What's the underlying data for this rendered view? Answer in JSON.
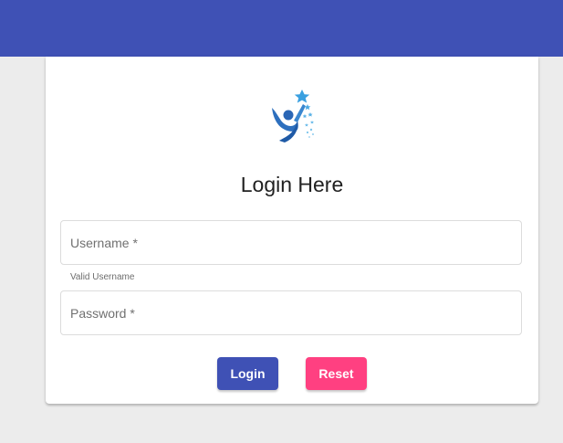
{
  "colors": {
    "topbar": "#3f51b5",
    "primary": "#3f51b5",
    "accent": "#ff4081",
    "background": "#ececec",
    "card": "#ffffff"
  },
  "logo": {
    "icon": "person-stars-logo"
  },
  "form": {
    "title": "Login Here",
    "username_placeholder": "Username *",
    "username_value": "",
    "username_hint": "Valid Username",
    "password_placeholder": "Password *",
    "password_value": "",
    "login_label": "Login",
    "reset_label": "Reset"
  }
}
